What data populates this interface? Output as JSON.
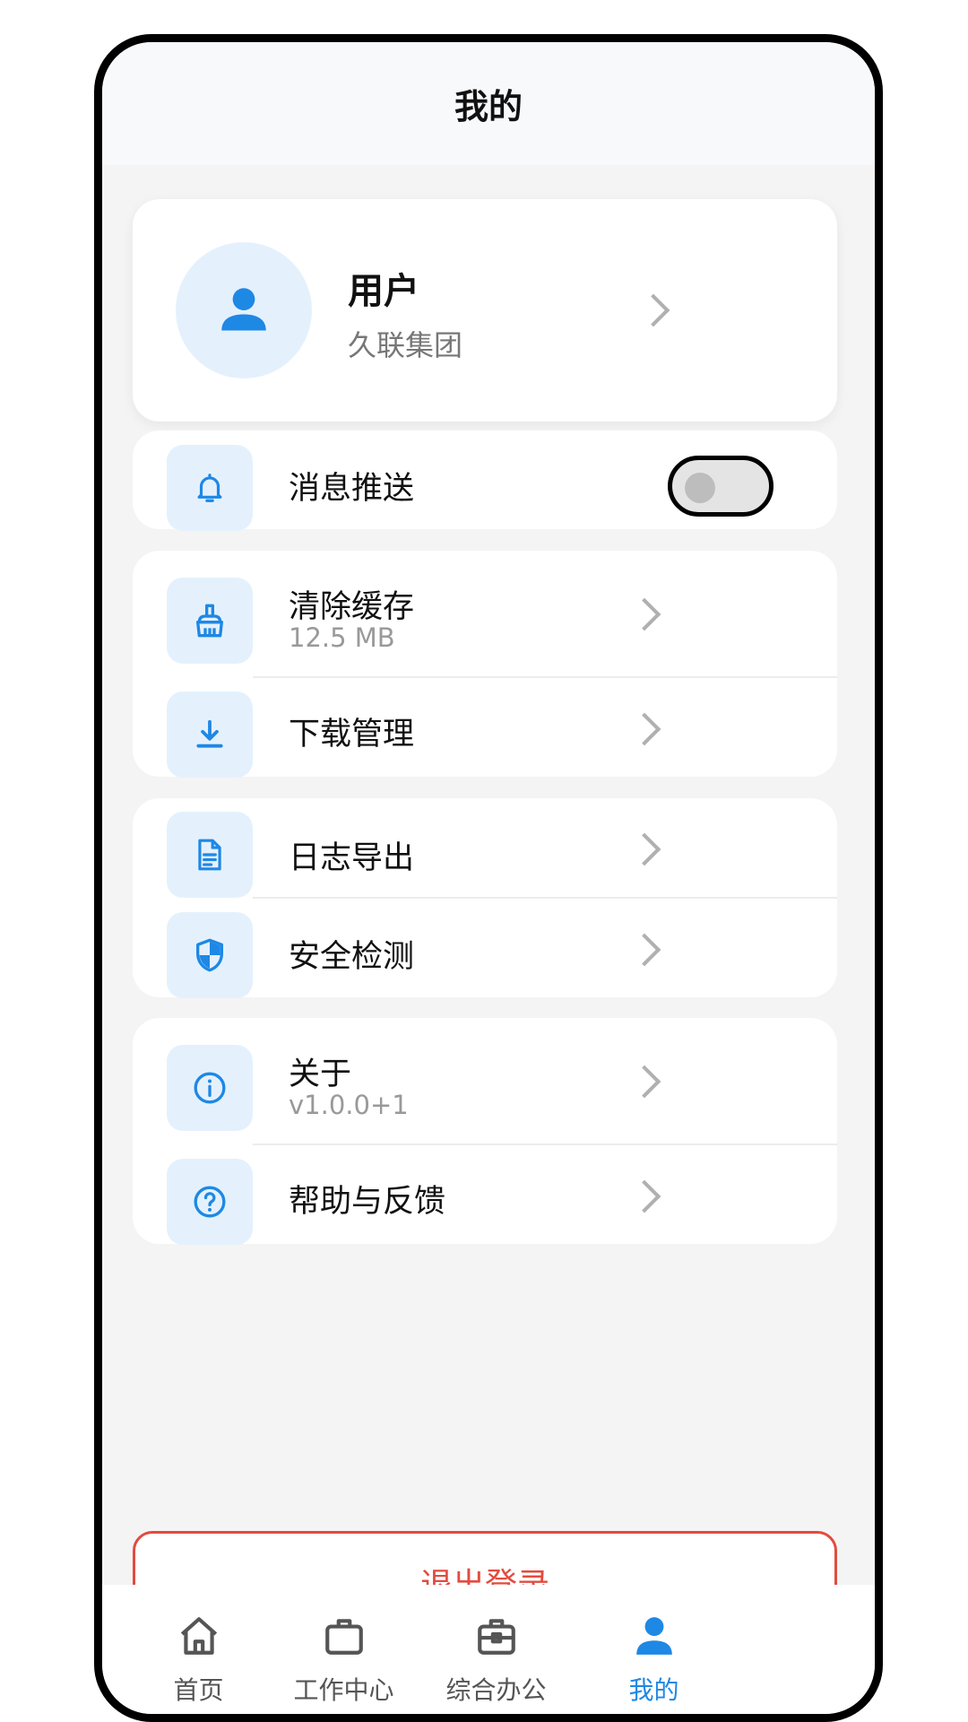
{
  "header": {
    "title": "我的"
  },
  "profile": {
    "name": "用户",
    "org": "久联集团"
  },
  "settings": {
    "push": {
      "label": "消息推送",
      "enabled": false
    },
    "cache": {
      "label": "清除缓存",
      "size": "12.5 MB"
    },
    "download": {
      "label": "下载管理"
    },
    "log_export": {
      "label": "日志导出"
    },
    "security": {
      "label": "安全检测"
    },
    "about": {
      "label": "关于",
      "version": "v1.0.0+1"
    },
    "help": {
      "label": "帮助与反馈"
    }
  },
  "logout": {
    "label": "退出登录"
  },
  "tabs": [
    {
      "label": "首页",
      "icon": "home-icon"
    },
    {
      "label": "工作中心",
      "icon": "briefcase-icon"
    },
    {
      "label": "综合办公",
      "icon": "toolbox-icon"
    },
    {
      "label": "我的",
      "icon": "person-icon"
    }
  ],
  "active_tab": "我的",
  "colors": {
    "accent": "#1e88e5",
    "danger": "#e34b3e",
    "icon_bg": "#e4f1fd",
    "page_bg": "#f4f4f4"
  }
}
